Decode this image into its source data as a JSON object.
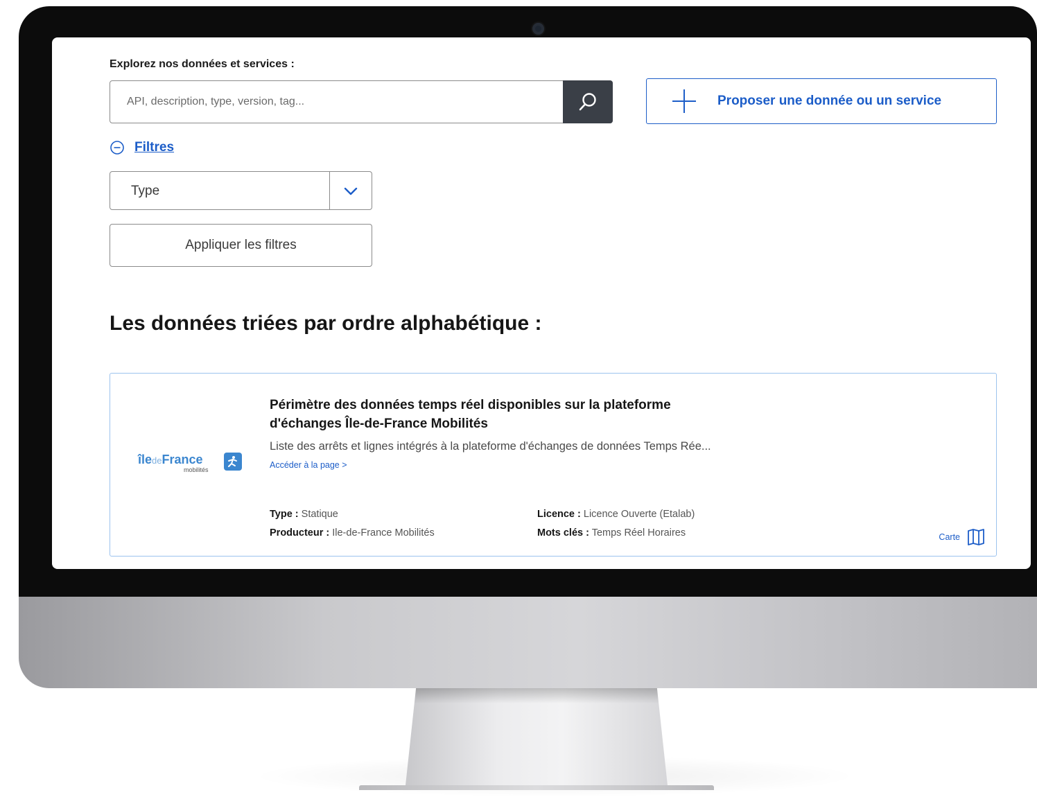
{
  "search": {
    "label": "Explorez nos données et services :",
    "placeholder": "API, description, type, version, tag...",
    "value": "",
    "submit_icon": "search-icon"
  },
  "propose": {
    "label": "Proposer une donnée ou un service",
    "icon": "plus-icon"
  },
  "filters": {
    "toggle_label": "Filtres",
    "toggle_icon": "minus-circle-icon",
    "type_select": {
      "selected": "Type",
      "icon": "chevron-down-icon"
    },
    "apply_label": "Appliquer les filtres"
  },
  "section": {
    "title": "Les données triées par ordre alphabétique :"
  },
  "results": [
    {
      "logo": {
        "word_ile": "île",
        "word_de": "de",
        "word_france": "France",
        "sub": "mobilités"
      },
      "title_line1": "Périmètre des données temps réel disponibles sur la plateforme",
      "title_line2": "d'échanges Île-de-France Mobilités",
      "description": "Liste des arrêts et lignes intégrés à la plateforme d'échanges de données Temps Rée...",
      "link_label": "Accéder à la page >",
      "type_label": "Type :",
      "type_value": " Statique",
      "producer_label": "Producteur :",
      "producer_value": " Ile-de-France Mobilités",
      "licence_label": "Licence :",
      "licence_value": " Licence Ouverte (Etalab)",
      "keywords_label": "Mots clés :",
      "keywords_value": " Temps Réel Horaires",
      "map_label": "Carte",
      "map_icon": "map-icon"
    }
  ],
  "colors": {
    "accent": "#1c5dc8",
    "search_button": "#3a3f47",
    "card_border": "#9cc3ee",
    "logo_blue": "#3b86cf"
  }
}
